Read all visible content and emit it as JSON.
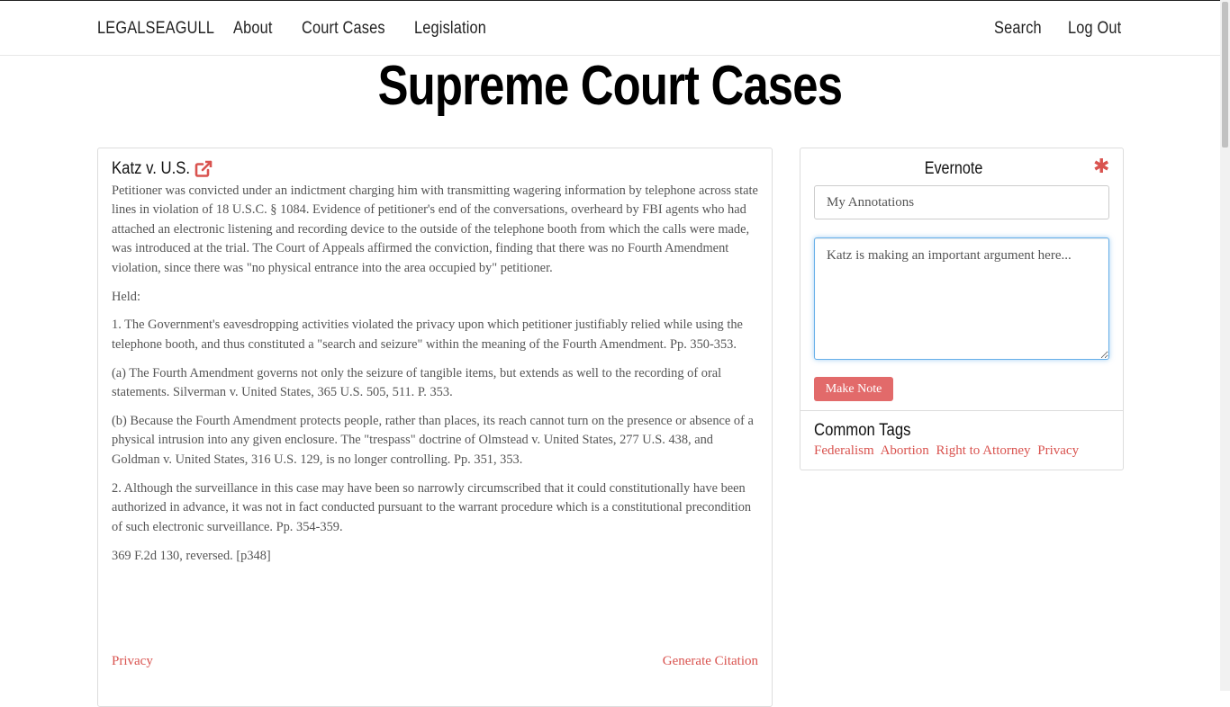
{
  "nav": {
    "brand": "LEGALSEAGULL",
    "about": "About",
    "court_cases": "Court Cases",
    "legislation": "Legislation",
    "search": "Search",
    "logout": "Log Out"
  },
  "page_title": "Supreme Court Cases",
  "case": {
    "title": "Katz v. U.S.",
    "link_icon": "external-link-icon",
    "paragraphs": [
      "Petitioner was convicted under an indictment charging him with transmitting wagering information by telephone across state lines in violation of 18 U.S.C. § 1084. Evidence of petitioner's end of the conversations, overheard by FBI agents who had attached an electronic listening and recording device to the outside of the telephone booth from which the calls were made, was introduced at the trial. The Court of Appeals affirmed the conviction, finding that there was no Fourth Amendment violation, since there was \"no physical entrance into the area occupied by\" petitioner.",
      "Held:",
      "1. The Government's eavesdropping activities violated the privacy upon which petitioner justifiably relied while using the telephone booth, and thus constituted a \"search and seizure\" within the meaning of the Fourth Amendment. Pp. 350-353.",
      "(a) The Fourth Amendment governs not only the seizure of tangible items, but extends as well to the recording of oral statements. Silverman v. United States, 365 U.S. 505, 511. P. 353.",
      "(b) Because the Fourth Amendment protects people, rather than places, its reach cannot turn on the presence or absence of a physical intrusion into any given enclosure. The \"trespass\" doctrine of Olmstead v. United States, 277 U.S. 438, and Goldman v. United States, 316 U.S. 129, is no longer controlling. Pp. 351, 353.",
      "2. Although the surveillance in this case may have been so narrowly circumscribed that it could constitutionally have been authorized in advance, it was not in fact conducted pursuant to the warrant procedure which is a constitutional precondition of such electronic surveillance. Pp. 354-359.",
      "369 F.2d 130, reversed. [p348]"
    ],
    "footer_left": "Privacy",
    "footer_right": "Generate Citation"
  },
  "evernote": {
    "title": "Evernote",
    "icon": "asterisk-icon",
    "icon_glyph": "✱",
    "notebook_value": "My Annotations",
    "note_value": "Katz is making an important argument here...",
    "button_label": "Make Note"
  },
  "tags": {
    "title": "Common Tags",
    "items": [
      "Federalism",
      "Abortion",
      "Right to Attorney",
      "Privacy"
    ]
  },
  "colors": {
    "accent": "#d9534f",
    "button": "#e26a6a",
    "focus_border": "#66afe9"
  }
}
